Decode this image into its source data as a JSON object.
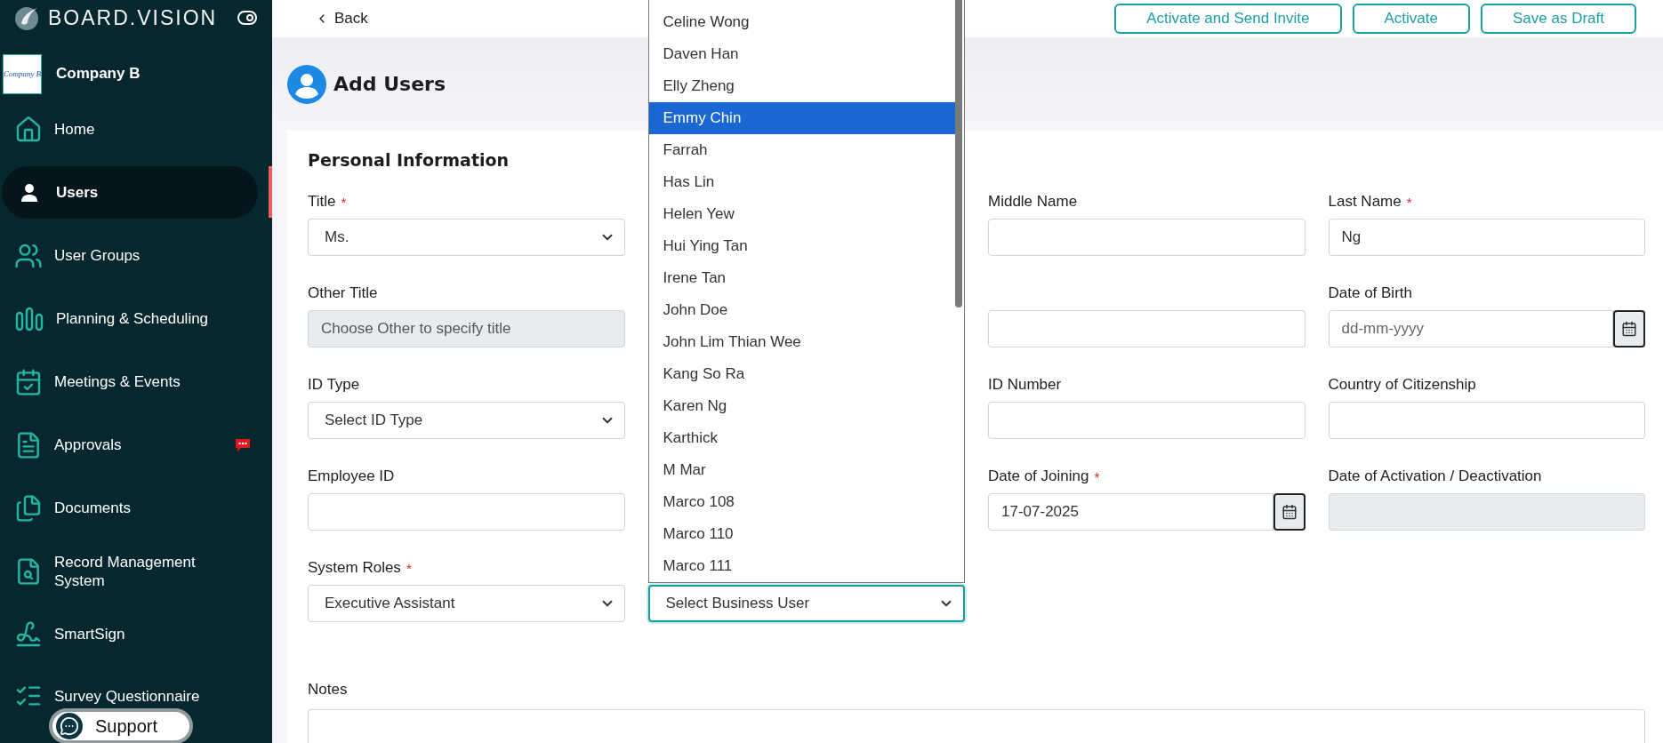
{
  "sidebar": {
    "brand": "BOARD.VISION",
    "company": {
      "logo_text": "Company B",
      "name": "Company B"
    },
    "items": [
      {
        "label": "Home",
        "selected": false,
        "notification": false
      },
      {
        "label": "Users",
        "selected": true,
        "notification": false
      },
      {
        "label": "User Groups",
        "selected": false,
        "notification": false
      },
      {
        "label": "Planning & Scheduling",
        "selected": false,
        "notification": false
      },
      {
        "label": "Meetings & Events",
        "selected": false,
        "notification": false
      },
      {
        "label": "Approvals",
        "selected": false,
        "notification": true
      },
      {
        "label": "Documents",
        "selected": false,
        "notification": false
      },
      {
        "label": "Record Management System",
        "selected": false,
        "notification": false
      },
      {
        "label": "SmartSign",
        "selected": false,
        "notification": false
      },
      {
        "label": "Survey Questionnaire",
        "selected": false,
        "notification": false
      }
    ]
  },
  "support": {
    "label": "Support"
  },
  "header": {
    "back": "Back",
    "actions": [
      "Activate and Send Invite",
      "Activate",
      "Save as Draft"
    ]
  },
  "page": {
    "title": "Add Users"
  },
  "section": {
    "title": "Personal Information",
    "rows": [
      [
        {
          "kind": "select",
          "label": "Title",
          "required_mark": "*",
          "value": "Ms.",
          "focused": false
        },
        {
          "kind": "covered"
        },
        {
          "kind": "text",
          "label": "Middle Name",
          "disabled": false
        },
        {
          "kind": "text",
          "label": "Last Name",
          "required_mark": "*",
          "value": "Ng",
          "disabled": false
        }
      ],
      [
        {
          "kind": "text",
          "label": "Other Title",
          "placeholder": "Choose Other to specify title",
          "disabled": true
        },
        {
          "kind": "covered"
        },
        {
          "kind": "text",
          "disabled": false
        },
        {
          "kind": "date",
          "label": "Date of Birth",
          "placeholder": "dd-mm-yyyy"
        }
      ],
      [
        {
          "kind": "select",
          "label": "ID Type",
          "value": "Select ID Type",
          "focused": false
        },
        {
          "kind": "covered"
        },
        {
          "kind": "text",
          "label": "ID Number",
          "disabled": false
        },
        {
          "kind": "text",
          "label": "Country of Citizenship",
          "disabled": false
        }
      ],
      [
        {
          "kind": "text",
          "label": "Employee ID",
          "disabled": false
        },
        {
          "kind": "covered"
        },
        {
          "kind": "date",
          "label": "Date of Joining",
          "required_mark": "*",
          "value": "17-07-2025"
        },
        {
          "kind": "text",
          "label": "Date of Activation / Deactivation",
          "disabled": true
        }
      ],
      [
        {
          "kind": "select",
          "label": "System Roles",
          "required_mark": "*",
          "value": "Executive Assistant",
          "focused": false
        },
        {
          "kind": "select",
          "value": "Select Business User",
          "focused": true,
          "options": [
            {
              "label": "Celine Wong",
              "selected": false
            },
            {
              "label": "Daven Han",
              "selected": false
            },
            {
              "label": "Elly Zheng",
              "selected": false
            },
            {
              "label": "Emmy Chin",
              "selected": true
            },
            {
              "label": "Farrah",
              "selected": false
            },
            {
              "label": "Has Lin",
              "selected": false
            },
            {
              "label": "Helen Yew",
              "selected": false
            },
            {
              "label": "Hui Ying Tan",
              "selected": false
            },
            {
              "label": "Irene Tan",
              "selected": false
            },
            {
              "label": "John Doe",
              "selected": false
            },
            {
              "label": "John Lim Thian Wee",
              "selected": false
            },
            {
              "label": "Kang So Ra",
              "selected": false
            },
            {
              "label": "Karen Ng",
              "selected": false
            },
            {
              "label": "Karthick",
              "selected": false
            },
            {
              "label": "M Mar",
              "selected": false
            },
            {
              "label": "Marco 108",
              "selected": false
            },
            {
              "label": "Marco 110",
              "selected": false
            },
            {
              "label": "Marco 111",
              "selected": false
            }
          ]
        }
      ]
    ],
    "notes": {
      "label": "Notes"
    }
  }
}
